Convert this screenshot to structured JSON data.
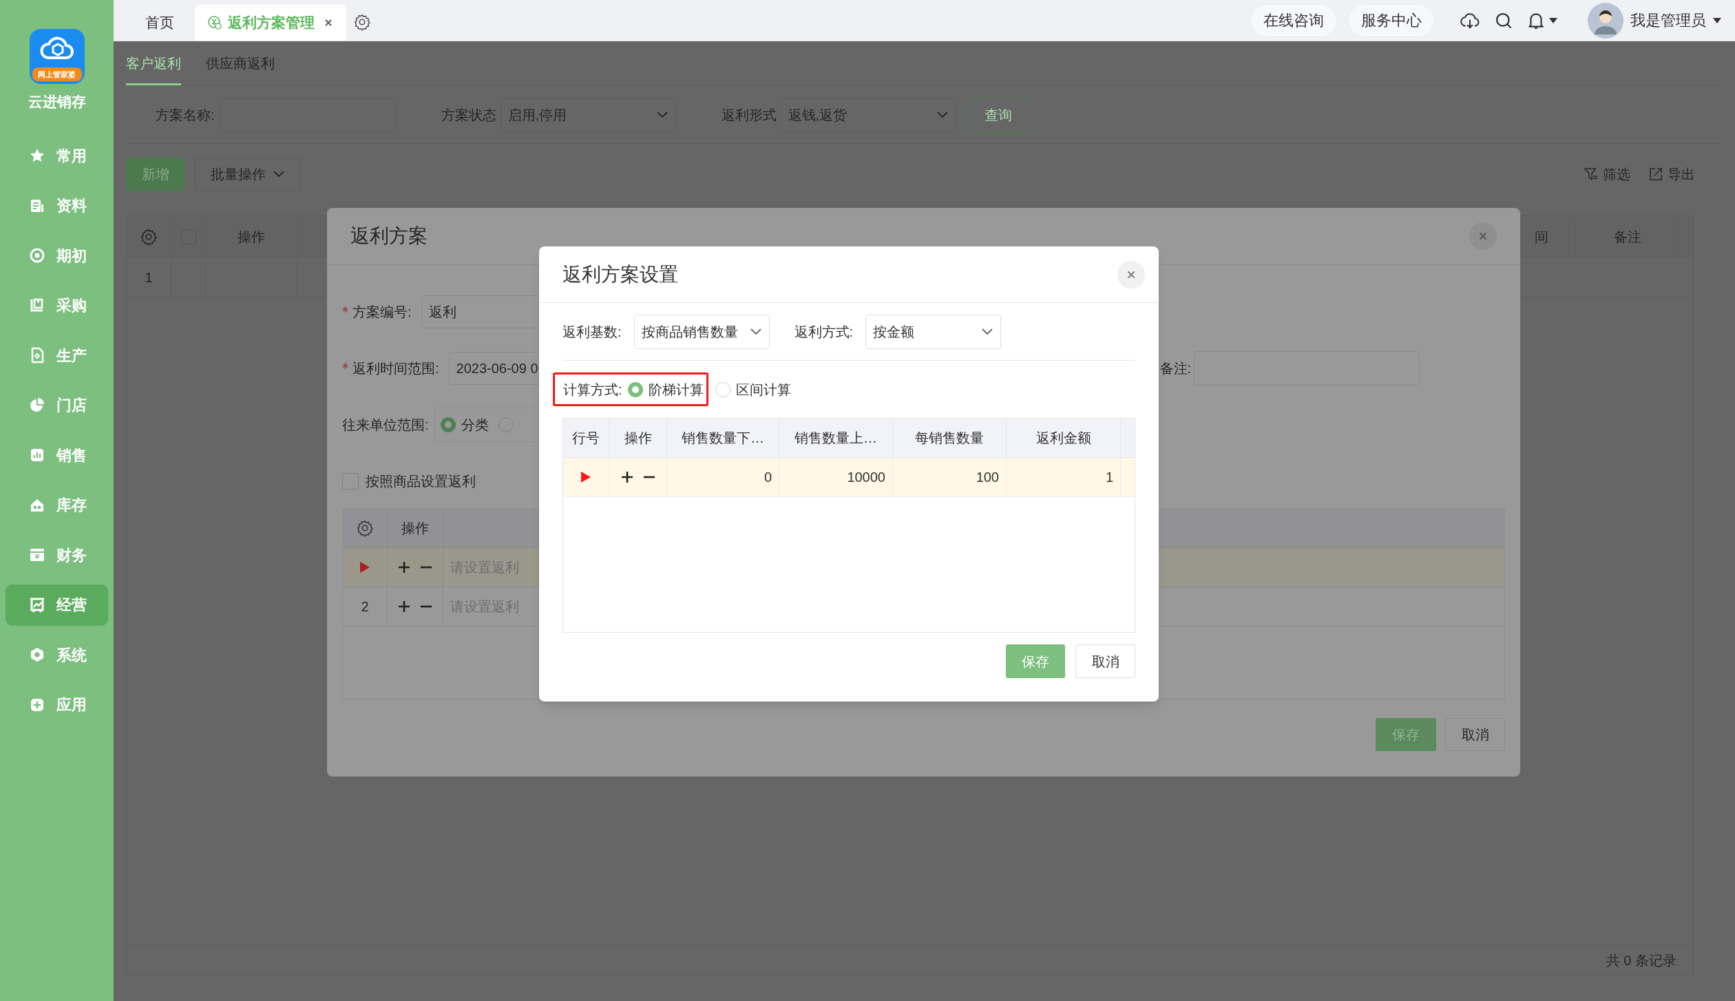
{
  "sidebar": {
    "logo_badge": "网上管家婆",
    "app_name": "云进销存",
    "items": [
      {
        "label": "常用",
        "selected": false
      },
      {
        "label": "资料",
        "selected": false
      },
      {
        "label": "期初",
        "selected": false
      },
      {
        "label": "采购",
        "selected": false
      },
      {
        "label": "生产",
        "selected": false
      },
      {
        "label": "门店",
        "selected": false
      },
      {
        "label": "销售",
        "selected": false
      },
      {
        "label": "库存",
        "selected": false
      },
      {
        "label": "财务",
        "selected": false
      },
      {
        "label": "经营",
        "selected": true
      },
      {
        "label": "系统",
        "selected": false
      },
      {
        "label": "应用",
        "selected": false
      }
    ]
  },
  "top_bar": {
    "tabs": [
      {
        "label": "首页",
        "selected": false
      },
      {
        "label": "返利方案管理",
        "selected": true
      }
    ],
    "buttons": [
      "在线咨询",
      "服务中心"
    ],
    "user": "我是管理员"
  },
  "page": {
    "subtabs": [
      {
        "label": "客户返利",
        "selected": true
      },
      {
        "label": "供应商返利",
        "selected": false
      }
    ],
    "filters": [
      {
        "label": "方案名称:",
        "kind": "input"
      },
      {
        "label": "方案状态",
        "kind": "select",
        "value": "启用,停用"
      },
      {
        "label": "返利形式",
        "kind": "select",
        "value": "返钱,返货"
      }
    ],
    "query_button": "查询",
    "add_button": "新增",
    "batch_button": "批量操作",
    "filter_link": "筛选",
    "export_link": "导出",
    "table": {
      "select_all_checked": false,
      "columns": [
        "操作",
        "间",
        "备注"
      ],
      "rows": [
        {
          "row_number": "1"
        }
      ]
    },
    "footer": "共 0 条记录"
  },
  "rebate_plan_dialog": {
    "title": "返利方案",
    "fields": [
      {
        "label": "方案编号:",
        "required": true,
        "value": "返利"
      },
      {
        "label": "返利时间范围:",
        "required": true,
        "value": "2023-06-09 0"
      }
    ],
    "remark_label": "备注:",
    "party_scope": {
      "label": "往来单位范围:",
      "options": [
        {
          "label": "分类",
          "selected": true
        },
        {
          "selected": false
        }
      ]
    },
    "by_product": {
      "label": "按照商品设置返利",
      "checked": false
    },
    "table": {
      "columns": [
        "操作"
      ],
      "rows": [
        {
          "selected": true,
          "text": "请设置返利"
        },
        {
          "selected": false,
          "row_number": "2",
          "text": "请设置返利"
        }
      ]
    },
    "buttons": [
      "保存",
      "取消"
    ]
  },
  "settings_dialog": {
    "title": "返利方案设置",
    "selects": [
      {
        "label": "返利基数:",
        "value": "按商品销售数量"
      },
      {
        "label": "返利方式:",
        "value": "按金额"
      }
    ],
    "calc": {
      "label": "计算方式:",
      "highlighted": true,
      "options": [
        {
          "label": "阶梯计算",
          "selected": true
        },
        {
          "label": "区间计算",
          "selected": false
        }
      ]
    },
    "table": {
      "columns": [
        "行号",
        "操作",
        "销售数量下…",
        "销售数量上…",
        "每销售数量",
        "返利金额"
      ],
      "rows": [
        {
          "selected": true,
          "cells": [
            "",
            "",
            "0",
            "10000",
            "100",
            "1"
          ]
        }
      ]
    },
    "buttons": [
      "保存",
      "取消"
    ]
  }
}
